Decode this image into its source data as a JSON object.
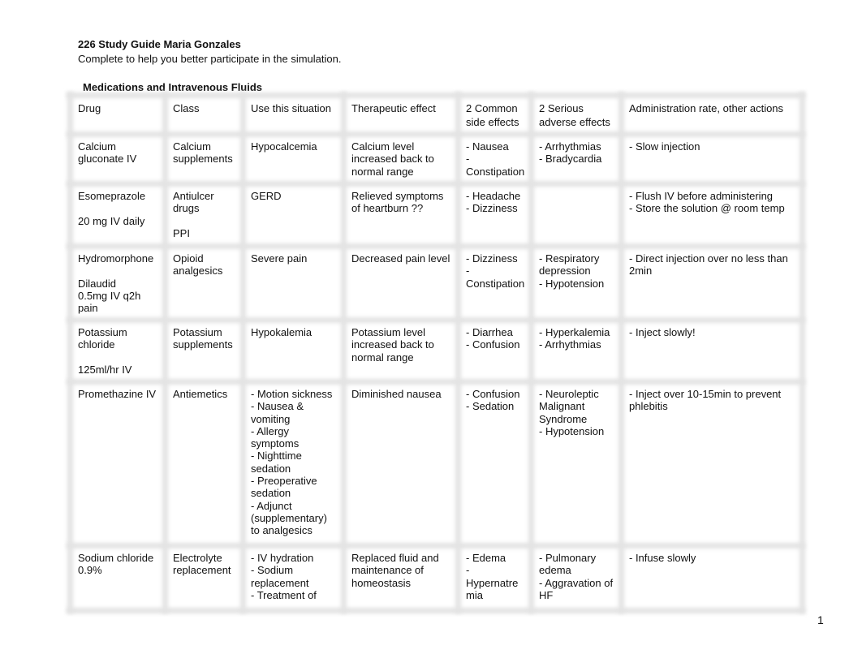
{
  "document": {
    "title": "226 Study Guide Maria Gonzales",
    "subtitle": "Complete to help you better participate in the simulation.",
    "section_title": "Medications and Intravenous Fluids",
    "page_number": "1"
  },
  "table": {
    "headers": [
      "Drug",
      "Class",
      "Use this situation",
      "Therapeutic effect",
      "2 Common\nside effects",
      "2 Serious\nadverse effects",
      "Administration rate, other actions"
    ],
    "rows": [
      {
        "drug": "Calcium\ngluconate IV",
        "class": "Calcium\nsupplements",
        "use": "Hypocalcemia",
        "effect": "Calcium level\nincreased back to\nnormal range",
        "common": "- Nausea\n-\nConstipation",
        "serious": "- Arrhythmias\n- Bradycardia",
        "admin": "- Slow injection"
      },
      {
        "drug": "Esomeprazole\n\n20 mg IV daily",
        "class": "Antiulcer\ndrugs\n\nPPI",
        "use": "GERD",
        "effect": "Relieved symptoms\nof heartburn ??",
        "common": "- Headache\n- Dizziness",
        "serious": "",
        "admin": "- Flush IV before administering\n- Store the solution @ room temp"
      },
      {
        "drug": "Hydromorphone\n\nDilaudid\n0.5mg IV q2h\npain",
        "class": "Opioid\nanalgesics",
        "use": "Severe pain",
        "effect": "Decreased pain level",
        "common": "- Dizziness\n-\nConstipation",
        "serious": "- Respiratory\ndepression\n- Hypotension",
        "admin": "- Direct injection over no less than\n2min"
      },
      {
        "drug": "Potassium\nchloride\n\n125ml/hr IV",
        "class": "Potassium\nsupplements",
        "use": "Hypokalemia",
        "effect": "Potassium level\nincreased back to\nnormal range",
        "common": "- Diarrhea\n- Confusion",
        "serious": "- Hyperkalemia\n- Arrhythmias",
        "admin": "- Inject slowly!"
      },
      {
        "drug": "Promethazine IV",
        "class": "Antiemetics",
        "use": "- Motion sickness\n- Nausea &\nvomiting\n- Allergy\nsymptoms\n- Nighttime\nsedation\n- Preoperative\nsedation\n- Adjunct\n(supplementary)\nto analgesics",
        "effect": "Diminished nausea",
        "common": "- Confusion\n- Sedation",
        "serious": "- Neuroleptic\nMalignant\nSyndrome\n- Hypotension",
        "admin": "- Inject over 10-15min to prevent\nphlebitis"
      },
      {
        "drug": "Sodium chloride\n0.9%",
        "class": "Electrolyte\nreplacement",
        "use": "- IV hydration\n- Sodium\nreplacement\n- Treatment of",
        "effect": "Replaced fluid and\nmaintenance of\nhomeostasis",
        "common": "- Edema\n-\nHypernatre\nmia",
        "serious": "- Pulmonary\nedema\n- Aggravation of\nHF",
        "admin": "- Infuse slowly"
      }
    ]
  }
}
